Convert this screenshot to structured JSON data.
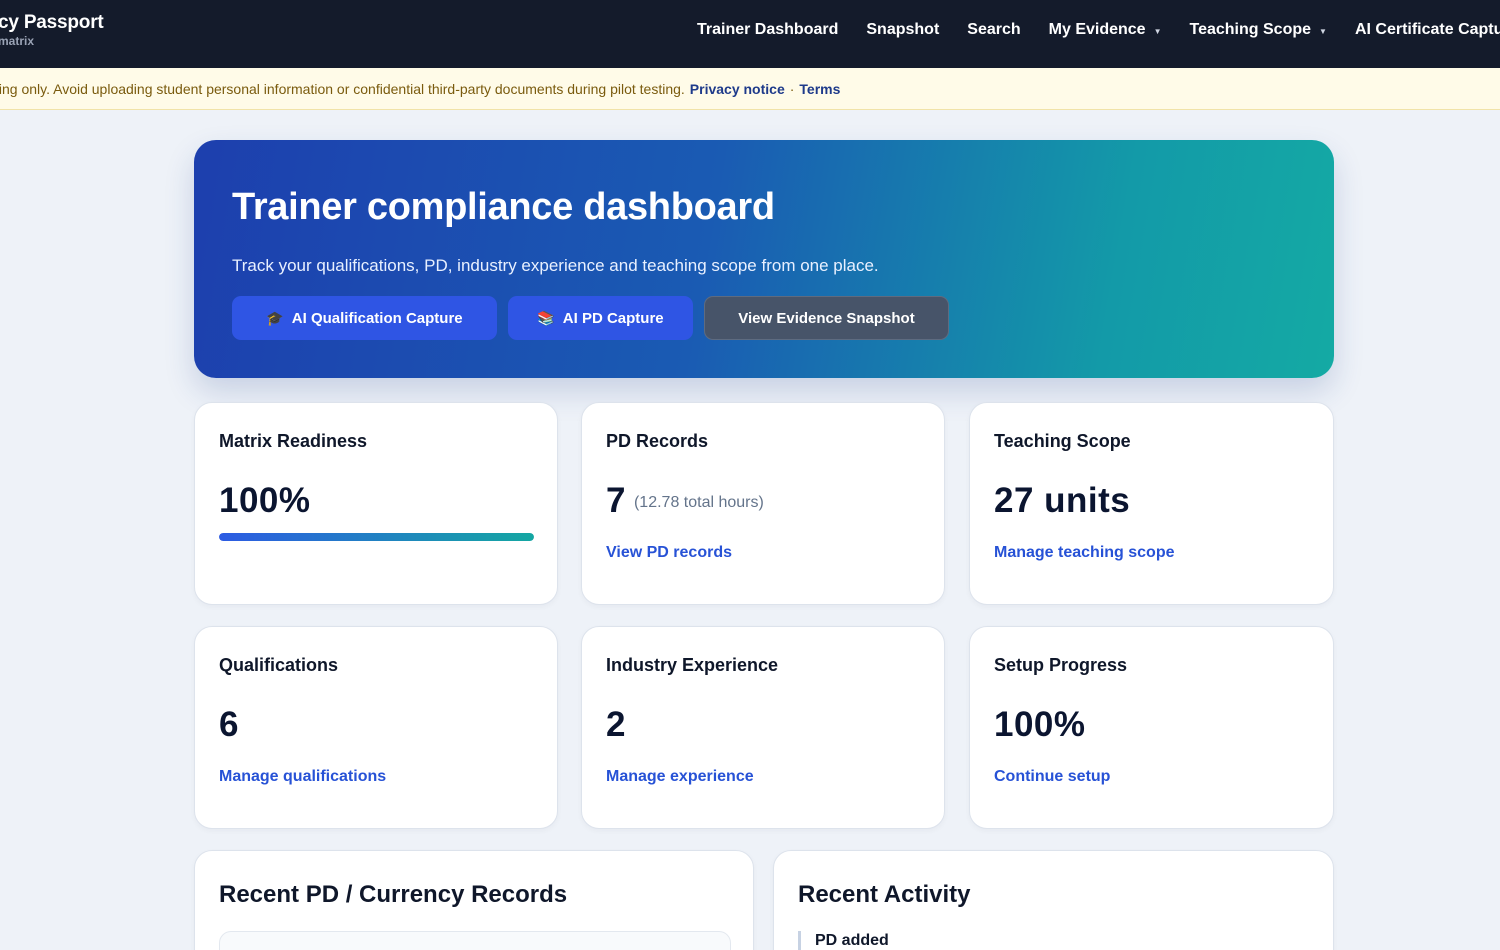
{
  "app": {
    "brand_title": "cy Passport",
    "brand_subtitle": "matrix"
  },
  "nav": {
    "items": [
      {
        "label": "Trainer Dashboard",
        "dropdown": false
      },
      {
        "label": "Snapshot",
        "dropdown": false
      },
      {
        "label": "Search",
        "dropdown": false
      },
      {
        "label": "My Evidence",
        "dropdown": true
      },
      {
        "label": "Teaching Scope",
        "dropdown": true
      },
      {
        "label": "AI Certificate Captu",
        "dropdown": false
      }
    ]
  },
  "notice": {
    "text": "ting only. Avoid uploading student personal information or confidential third-party documents during pilot testing.",
    "privacy_link": "Privacy notice",
    "separator": "·",
    "terms_link": "Terms"
  },
  "hero": {
    "title": "Trainer compliance dashboard",
    "subtitle": "Track your qualifications, PD, industry experience and teaching scope from one place.",
    "buttons": {
      "qualification": {
        "label": "AI Qualification Capture",
        "icon": "certificate-icon"
      },
      "pd": {
        "label": "AI PD Capture",
        "icon": "books-icon"
      },
      "snapshot": {
        "label": "View Evidence Snapshot"
      }
    }
  },
  "cards": {
    "matrix_readiness": {
      "label": "Matrix Readiness",
      "value": "100%",
      "progress_percent": 100
    },
    "pd_records": {
      "label": "PD Records",
      "value": "7",
      "note": "(12.78 total hours)",
      "link": "View PD records"
    },
    "teaching_scope": {
      "label": "Teaching Scope",
      "value": "27 units",
      "link": "Manage teaching scope"
    },
    "qualifications": {
      "label": "Qualifications",
      "value": "6",
      "link": "Manage qualifications"
    },
    "industry_experience": {
      "label": "Industry Experience",
      "value": "2",
      "link": "Manage experience"
    },
    "setup_progress": {
      "label": "Setup Progress",
      "value": "100%",
      "link": "Continue setup"
    }
  },
  "panels": {
    "recent_pd": {
      "title": "Recent PD / Currency Records"
    },
    "recent_activity": {
      "title": "Recent Activity",
      "items": [
        "PD added"
      ]
    }
  },
  "colors": {
    "nav_bg": "#141b2b",
    "notice_bg": "#fffbe8",
    "accent_blue": "#2f55e4",
    "link_blue": "#2752d6",
    "hero_start": "#1d3fae",
    "hero_end": "#14aaa4"
  }
}
